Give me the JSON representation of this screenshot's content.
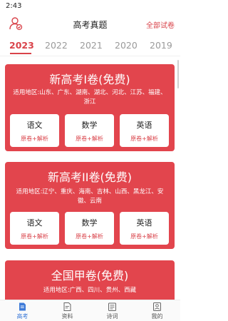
{
  "status": {
    "time": "2:43"
  },
  "header": {
    "title": "高考真题",
    "all_papers": "全部试卷"
  },
  "years": [
    "2023",
    "2022",
    "2021",
    "2020",
    "2019"
  ],
  "cards": [
    {
      "title": "新高考I卷(免费)",
      "region": "适用地区:山东、广东、湖南、湖北、河北、江苏、福建、浙江",
      "subjects": [
        {
          "name": "语文",
          "desc": "原卷+解析"
        },
        {
          "name": "数学",
          "desc": "原卷+解析"
        },
        {
          "name": "英语",
          "desc": "原卷+解析"
        }
      ]
    },
    {
      "title": "新高考II卷(免费)",
      "region": "适用地区:辽宁、重庆、海南、吉林、山西、黑龙江、安徽、云南",
      "subjects": [
        {
          "name": "语文",
          "desc": "原卷+解析"
        },
        {
          "name": "数学",
          "desc": "原卷+解析"
        },
        {
          "name": "英语",
          "desc": "原卷+解析"
        }
      ]
    },
    {
      "title": "全国甲卷(免费)",
      "region": "适用地区:广西、四川、贵州、西藏"
    }
  ],
  "tabs": [
    {
      "label": "高考",
      "icon": "exam-doc-icon"
    },
    {
      "label": "资料",
      "icon": "materials-icon"
    },
    {
      "label": "诗词",
      "icon": "poetry-icon"
    },
    {
      "label": "我的",
      "icon": "profile-icon"
    }
  ],
  "colors": {
    "accent": "#d9434a",
    "card": "#e2454d",
    "tab_active": "#3e7bd8"
  }
}
